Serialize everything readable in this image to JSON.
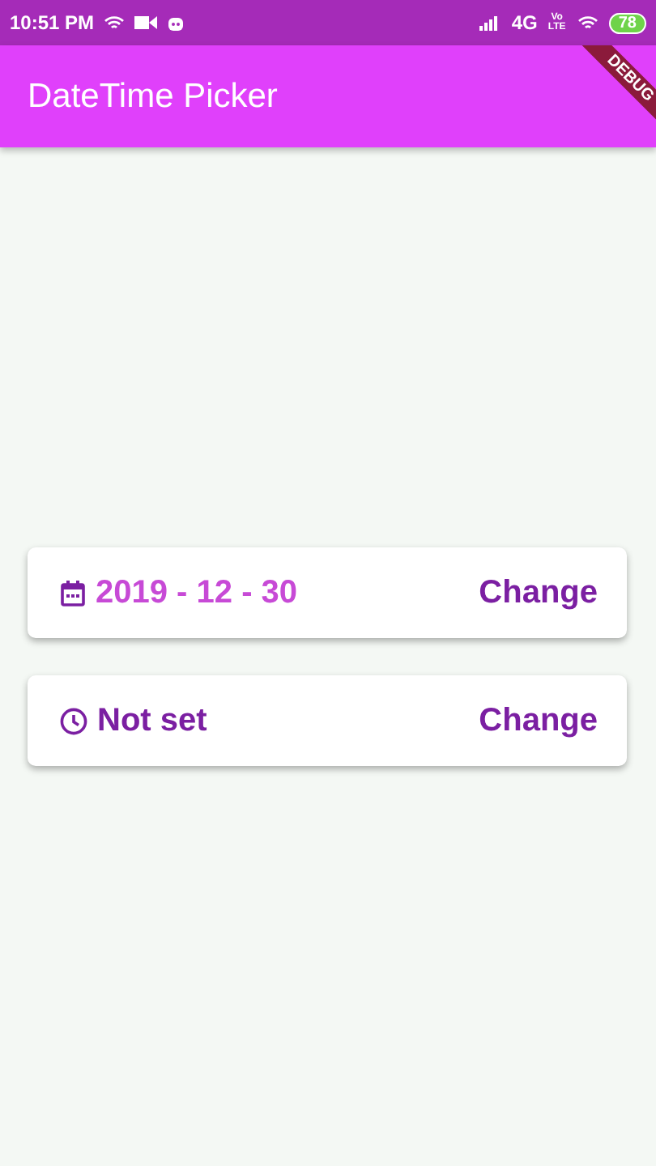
{
  "status_bar": {
    "time": "10:51 PM",
    "network": "4G",
    "volte": "Vo LTE",
    "battery": "78"
  },
  "debug_banner": "DEBUG",
  "app_bar": {
    "title": "DateTime Picker"
  },
  "pickers": [
    {
      "kind": "date",
      "value": "2019 - 12 - 30",
      "set": true,
      "action": "Change"
    },
    {
      "kind": "time",
      "value": "Not set",
      "set": false,
      "action": "Change"
    }
  ]
}
